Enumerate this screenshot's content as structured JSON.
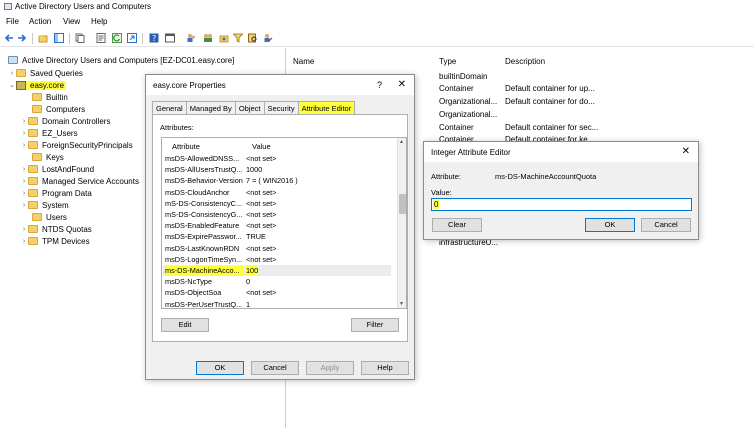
{
  "window": {
    "title": "Active Directory Users and Computers"
  },
  "menu": [
    "File",
    "Action",
    "View",
    "Help"
  ],
  "toolbar_icons": [
    "back-icon",
    "forward-icon",
    "folder-icon",
    "console-tree-icon",
    "copy-icon",
    "properties-icon",
    "refresh-icon",
    "export-icon",
    "help-icon",
    "console-icon",
    "users-icon",
    "group-icon",
    "filter-icon",
    "ou-icon",
    "delegate-icon"
  ],
  "tree": {
    "root": "Active Directory Users and Computers [EZ-DC01.easy.core]",
    "saved_queries": "Saved Queries",
    "domain": "easy.core",
    "children": [
      "Builtin",
      "Computers",
      "Domain Controllers",
      "EZ_Users",
      "ForeignSecurityPrincipals",
      "Keys",
      "LostAndFound",
      "Managed Service Accounts",
      "Program Data",
      "System",
      "Users",
      "NTDS Quotas",
      "TPM Devices"
    ]
  },
  "list": {
    "headers": {
      "name": "Name",
      "type": "Type",
      "description": "Description"
    },
    "rows": [
      {
        "type": "builtinDomain",
        "description": ""
      },
      {
        "type": "Container",
        "description": "Default container for up..."
      },
      {
        "type": "Organizational...",
        "description": "Default container for do..."
      },
      {
        "type": "Organizational...",
        "description": ""
      },
      {
        "type": "Container",
        "description": "Default container for sec..."
      },
      {
        "type": "Container",
        "description": "Default container for ke..."
      }
    ],
    "last_row_type": "infrastructureU..."
  },
  "properties": {
    "title": "easy.core Properties",
    "help_glyph": "?",
    "tabs": [
      "General",
      "Managed By",
      "Object",
      "Security",
      "Attribute Editor"
    ],
    "attributes_label": "Attributes:",
    "col_attribute": "Attribute",
    "col_value": "Value",
    "rows": [
      {
        "name": "msDS-AllowedDNSS...",
        "value": "<not set>"
      },
      {
        "name": "msDS-AllUsersTrustQ...",
        "value": "1000"
      },
      {
        "name": "msDS-Behavior-Version",
        "value": "7 = ( WIN2016 )"
      },
      {
        "name": "msDS-CloudAnchor",
        "value": "<not set>"
      },
      {
        "name": "mS-DS-ConsistencyC...",
        "value": "<not set>"
      },
      {
        "name": "mS-DS-ConsistencyG...",
        "value": "<not set>"
      },
      {
        "name": "msDS-EnabledFeature",
        "value": "<not set>"
      },
      {
        "name": "msDS-ExpirePasswor...",
        "value": "TRUE"
      },
      {
        "name": "msDS-LastKnownRDN",
        "value": "<not set>"
      },
      {
        "name": "msDS-LogonTimeSyn...",
        "value": "<not set>"
      },
      {
        "name": "ms-DS-MachineAcco...",
        "value": "100"
      },
      {
        "name": "msDS-NcType",
        "value": "0"
      },
      {
        "name": "msDS-ObjectSoa",
        "value": "<not set>"
      },
      {
        "name": "msDS-PerUserTrustQ...",
        "value": "1"
      }
    ],
    "selected_index": 10,
    "edit_label": "Edit",
    "filter_label": "Filter",
    "ok_label": "OK",
    "cancel_label": "Cancel",
    "apply_label": "Apply",
    "help_label": "Help"
  },
  "integer_editor": {
    "title": "Integer Attribute Editor",
    "attribute_label": "Attribute:",
    "attribute_value": "ms-DS-MachineAccountQuota",
    "value_label": "Value:",
    "value": "0",
    "clear_label": "Clear",
    "ok_label": "OK",
    "cancel_label": "Cancel"
  },
  "colors": {
    "highlight": "#ffff3c",
    "focus_border": "#0078d7",
    "dialog_bg": "#f0f0f0"
  }
}
